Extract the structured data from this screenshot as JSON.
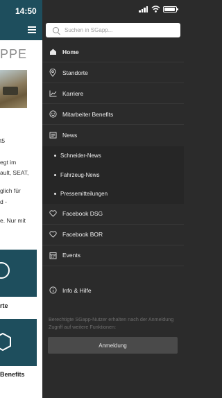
{
  "status_bar": {
    "time": "14:50"
  },
  "background": {
    "title_fragment": "PPE",
    "text_lines": [
      "t5",
      "egt im",
      "ault, SEAT,",
      "glich für",
      "d -",
      "e. Nur mit"
    ],
    "tile_labels": [
      "rte",
      "Benefits"
    ]
  },
  "search": {
    "placeholder": "Suchen in SGapp..."
  },
  "menu": {
    "items": [
      {
        "label": "Home",
        "icon": "home-icon"
      },
      {
        "label": "Standorte",
        "icon": "location-pin-icon"
      },
      {
        "label": "Karriere",
        "icon": "chart-line-icon"
      },
      {
        "label": "Mitarbeiter Benefits",
        "icon": "smiley-icon"
      },
      {
        "label": "News",
        "icon": "news-icon"
      }
    ],
    "news_subitems": [
      {
        "label": "Schneider-News"
      },
      {
        "label": "Fahrzeug-News"
      },
      {
        "label": "Pressemitteilungen"
      }
    ],
    "items_after": [
      {
        "label": "Facebook DSG",
        "icon": "heart-icon"
      },
      {
        "label": "Facebook BOR",
        "icon": "heart-icon"
      },
      {
        "label": "Events",
        "icon": "calendar-icon"
      },
      {
        "label": "Info & Hilfe",
        "icon": "info-icon"
      }
    ]
  },
  "login_note": "Berechtigte SGapp-Nutzer erhalten nach der Anmeldung Zugriff auf weitere Funktionen:",
  "login_button": "Anmeldung"
}
